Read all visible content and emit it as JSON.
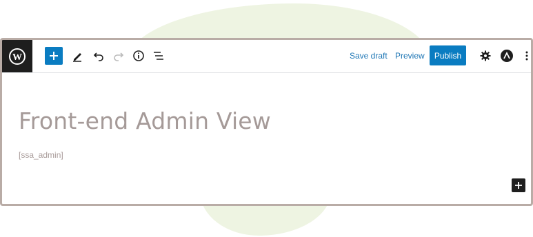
{
  "page": {
    "title": "Front-end Admin View",
    "shortcode": "[ssa_admin]"
  },
  "toolbar": {
    "save_draft": "Save draft",
    "preview": "Preview",
    "publish": "Publish",
    "icons": [
      "wordpress-logo-icon",
      "plus-icon",
      "pencil-icon",
      "undo-icon",
      "redo-icon",
      "info-icon",
      "list-view-icon",
      "gear-icon",
      "account-icon",
      "more-vertical-icon"
    ]
  },
  "colors": {
    "accent": "#0a7cc1",
    "dark": "#1e1e1e",
    "frame": "#b9aca6",
    "title": "#a59a98",
    "blob": "#eef4e2"
  }
}
